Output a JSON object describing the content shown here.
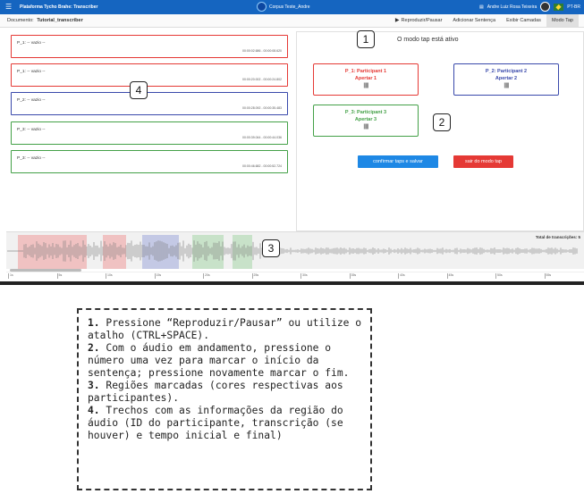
{
  "topbar": {
    "menu_icon": "menu-icon",
    "app_title": "Plataforma Tycho Brahe: Transcriber",
    "corpus_label": "Corpus Teste_Andre",
    "user_icon": "user-icon",
    "user_name": "Andre Luiz Rosa Teixeira",
    "language": "PT-BR"
  },
  "docbar": {
    "doc_label": "Documento:",
    "doc_name": "Tutorial_transcriber",
    "actions": [
      "Reproduzir/Pausar",
      "Adicionar Sentença",
      "Exibir Camadas",
      "Modo Tap"
    ]
  },
  "segments": [
    {
      "text": "P_1: -- vazio --",
      "time": "00:00:02.686  -  00:00:08.620",
      "color": "#e53935"
    },
    {
      "text": "P_1: -- vazio --",
      "time": "00:00:20.002  -  00:00:24.802",
      "color": "#e53935"
    },
    {
      "text": "P_2: -- vazio --",
      "time": "00:00:28.092  -  00:00:35.483",
      "color": "#3949ab"
    },
    {
      "text": "P_3: -- vazio --",
      "time": "00:00:39.044  -  00:00:44.036",
      "color": "#43a047"
    },
    {
      "text": "P_3: -- vazio --",
      "time": "00:00:46.682  -  00:00:52.724",
      "color": "#43a047"
    }
  ],
  "tap": {
    "status": "O modo tap está ativo",
    "participants": [
      {
        "name": "P_1: Participant 1",
        "action": "Apertar 1",
        "color": "#e53935"
      },
      {
        "name": "P_2: Participant 2",
        "action": "Apertar 2",
        "color": "#3949ab"
      },
      {
        "name": "P_3: Participant 3",
        "action": "Apertar 3",
        "color": "#43a047"
      }
    ],
    "wave_glyph": "|||||",
    "confirm_label": "confirmar taps e salvar",
    "exit_label": "sair do modo tap",
    "confirm_color": "#1e88e5",
    "exit_color": "#e53935"
  },
  "waveform": {
    "total_label": "Total de transcrições: 5",
    "regions_colors": [
      "#ef9a9a",
      "#ef9a9a",
      "#9fa8da",
      "#a5d6a7",
      "#a5d6a7"
    ]
  },
  "timeline_ticks": [
    "1s",
    "5s",
    "10s",
    "15s",
    "20s",
    "25s",
    "30s",
    "35s",
    "40s",
    "45s",
    "50s",
    "55s"
  ],
  "callouts": [
    "1",
    "2",
    "3",
    "4"
  ],
  "legend": [
    {
      "num": "1.",
      "text": "Pressione “Reproduzir/Pausar” ou utilize o atalho (CTRL+SPACE)."
    },
    {
      "num": "2.",
      "text": "Com o áudio em andamento, pressione o número uma vez para marcar o início da sentença; pressione novamente marcar o fim."
    },
    {
      "num": "3.",
      "text": "Regiões marcadas (cores respectivas aos participantes)."
    },
    {
      "num": "4.",
      "text": "Trechos com as informações da região do áudio (ID do participante, transcrição (se houver) e tempo inicial e final)"
    }
  ]
}
